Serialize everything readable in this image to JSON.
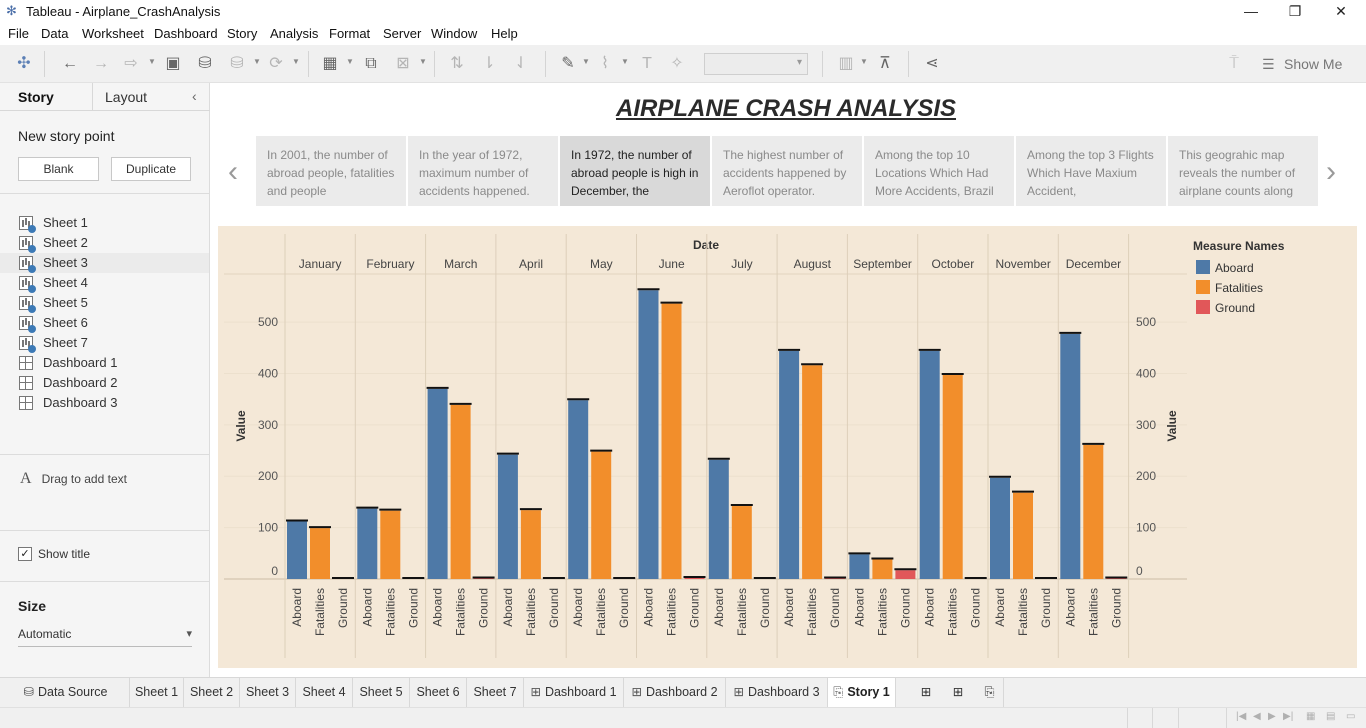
{
  "window": {
    "title": "Tableau - Airplane_CrashAnalysis",
    "minimize": "—",
    "restore": "❐",
    "close": "✕"
  },
  "menu": [
    "File",
    "Data",
    "Worksheet",
    "Dashboard",
    "Story",
    "Analysis",
    "Format",
    "Server",
    "Window",
    "Help"
  ],
  "toolbar": {
    "show_me_label": "Show Me",
    "icons": [
      "tableau-logo-icon",
      "undo-icon",
      "redo-icon",
      "replay-icon",
      "save-icon",
      "new-datasource-icon",
      "pause-updates-icon",
      "refresh-icon",
      "new-sheet-icon",
      "duplicate-sheet-icon",
      "clear-sheet-icon",
      "swap-icon",
      "sort-ascending-icon",
      "sort-descending-icon",
      "highlight-icon",
      "annotate-icon",
      "label-icon",
      "pin-icon",
      "fit-icon",
      "presentation-icon",
      "share-icon",
      "format-painter-icon"
    ]
  },
  "left_pane": {
    "tabs": [
      "Story",
      "Layout"
    ],
    "collapse_icon": "‹",
    "new_story_point": "New story point",
    "blank_button": "Blank",
    "duplicate_button": "Duplicate",
    "sheets": [
      {
        "label": "Sheet 1",
        "type": "sheet"
      },
      {
        "label": "Sheet 2",
        "type": "sheet"
      },
      {
        "label": "Sheet 3",
        "type": "sheet"
      },
      {
        "label": "Sheet 4",
        "type": "sheet"
      },
      {
        "label": "Sheet 5",
        "type": "sheet"
      },
      {
        "label": "Sheet 6",
        "type": "sheet"
      },
      {
        "label": "Sheet 7",
        "type": "sheet"
      },
      {
        "label": "Dashboard 1",
        "type": "dashboard"
      },
      {
        "label": "Dashboard 2",
        "type": "dashboard"
      },
      {
        "label": "Dashboard 3",
        "type": "dashboard"
      }
    ],
    "drag_text": "Drag to add text",
    "drag_icon": "A",
    "show_title_label": "Show title",
    "show_title_checked": "✓",
    "size_label": "Size",
    "size_value": "Automatic"
  },
  "story": {
    "title": "AIRPLANE CRASH ANALYSIS",
    "prev_arrow": "‹",
    "next_arrow": "›",
    "points": [
      "In 2001, the number of abroad people, fatalities and people",
      "In the year of 1972, maximum number of accidents happened.",
      "In 1972, the number of abroad people is high in  December, the",
      "The highest number of accidents happened by Aeroflot operator.",
      "Among the top 10 Locations Which Had More Accidents, Brazil",
      "Among the top 3 Flights Which Have Maxium Accident,",
      "This geograhic map reveals the number of airplane counts along"
    ],
    "active_point": 2
  },
  "chart_data": {
    "type": "bar",
    "column_header": "Date",
    "categories": [
      "January",
      "February",
      "March",
      "April",
      "May",
      "June",
      "July",
      "August",
      "September",
      "October",
      "November",
      "December"
    ],
    "sub_categories": [
      "Aboard",
      "Fatalities",
      "Ground"
    ],
    "series": [
      {
        "name": "Aboard",
        "color": "#4e79a7",
        "values": [
          112,
          137,
          370,
          242,
          348,
          562,
          232,
          444,
          48,
          444,
          197,
          477
        ]
      },
      {
        "name": "Fatalities",
        "color": "#f28e2b",
        "values": [
          99,
          133,
          339,
          134,
          248,
          536,
          142,
          416,
          38,
          397,
          168,
          261
        ]
      },
      {
        "name": "Ground",
        "color": "#e15759",
        "values": [
          0,
          0,
          1,
          0,
          0,
          2,
          0,
          1,
          17,
          0,
          0,
          1
        ]
      }
    ],
    "ylabel": "Value",
    "ylim": [
      0,
      580
    ],
    "yticks": [
      0,
      100,
      200,
      300,
      400,
      500
    ],
    "legend_title": "Measure Names",
    "legend_position": "right"
  },
  "bottom_tabs": [
    {
      "label": "Data Source",
      "icon": "⛁"
    },
    {
      "label": "Sheet 1"
    },
    {
      "label": "Sheet 2"
    },
    {
      "label": "Sheet 3"
    },
    {
      "label": "Sheet 4"
    },
    {
      "label": "Sheet 5"
    },
    {
      "label": "Sheet 6"
    },
    {
      "label": "Sheet 7"
    },
    {
      "label": "Dashboard 1",
      "icon": "⊞"
    },
    {
      "label": "Dashboard 2",
      "icon": "⊞"
    },
    {
      "label": "Dashboard 3",
      "icon": "⊞"
    },
    {
      "label": "Story 1",
      "icon": "⎘",
      "active": true
    }
  ],
  "new_tab_icons": [
    "new-worksheet-icon",
    "new-dashboard-icon",
    "new-story-icon"
  ]
}
